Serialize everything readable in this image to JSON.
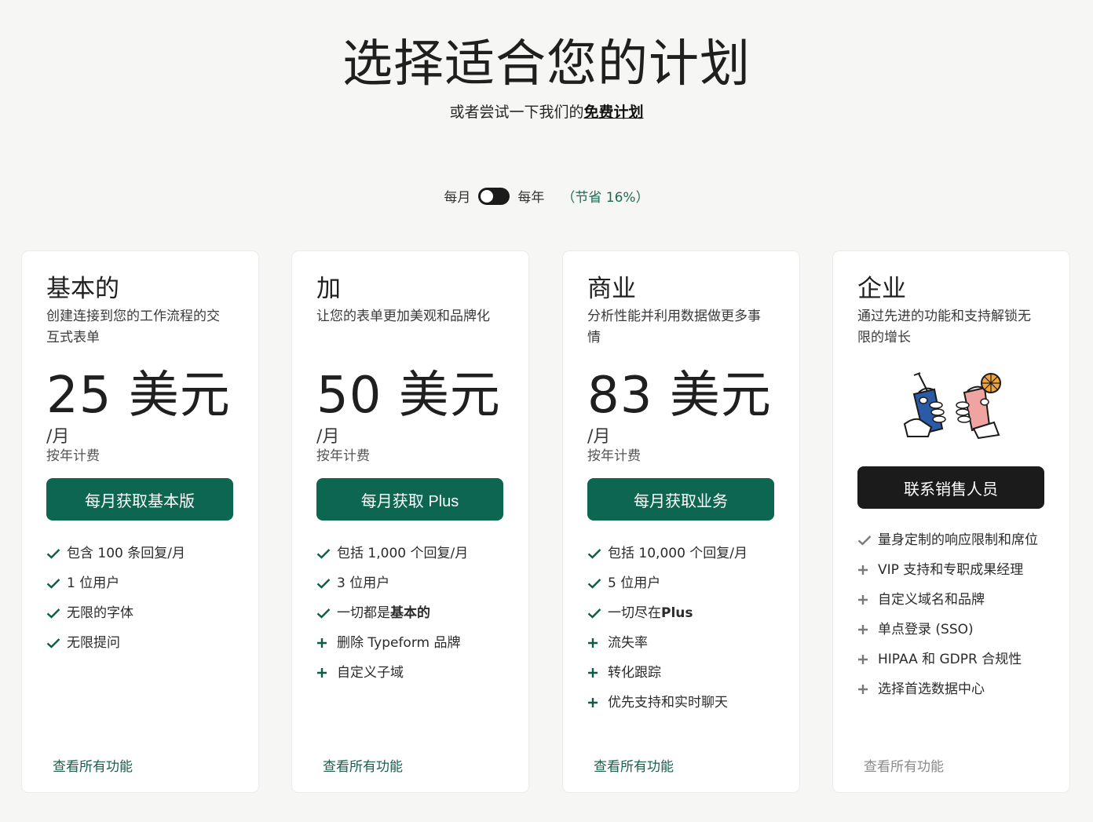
{
  "header": {
    "title": "选择适合您的计划",
    "subtitle_prefix": "或者尝试一下我们的",
    "subtitle_link": "免费计划"
  },
  "billing": {
    "monthly_label": "每月",
    "yearly_label": "每年",
    "savings": "（节省 16%）"
  },
  "plans": [
    {
      "name": "基本的",
      "description": "创建连接到您的工作流程的交互式表单",
      "price": "25 美元",
      "period": "/月",
      "billed": "按年计费",
      "cta": "每月获取基本版",
      "features": [
        {
          "icon": "check-icon",
          "text": "包含 100 条回复/月"
        },
        {
          "icon": "check-icon",
          "text": "1 位用户"
        },
        {
          "icon": "check-icon",
          "text": "无限的字体"
        },
        {
          "icon": "check-icon",
          "text": "无限提问"
        }
      ],
      "link": "查看所有功能"
    },
    {
      "name": "加",
      "description": "让您的表单更加美观和品牌化",
      "price": "50 美元",
      "period": "/月",
      "billed": "按年计费",
      "cta": "每月获取 Plus",
      "features": [
        {
          "icon": "check-icon",
          "text": "包括 1,000 个回复/月"
        },
        {
          "icon": "check-icon",
          "text": "3 位用户"
        },
        {
          "icon": "check-icon",
          "text": "一切都是",
          "bold": "基本的"
        },
        {
          "icon": "plus-icon",
          "text": "删除 Typeform 品牌"
        },
        {
          "icon": "plus-icon",
          "text": "自定义子域"
        }
      ],
      "link": "查看所有功能"
    },
    {
      "name": "商业",
      "description": "分析性能并利用数据做更多事情",
      "price": "83 美元",
      "period": "/月",
      "billed": "按年计费",
      "cta": "每月获取业务",
      "features": [
        {
          "icon": "check-icon",
          "text": "包括 10,000 个回复/月"
        },
        {
          "icon": "check-icon",
          "text": "5 位用户"
        },
        {
          "icon": "check-icon",
          "text": "一切尽在",
          "bold": "Plus"
        },
        {
          "icon": "plus-icon",
          "text": "流失率"
        },
        {
          "icon": "plus-icon",
          "text": "转化跟踪"
        },
        {
          "icon": "plus-icon",
          "text": "优先支持和实时聊天"
        }
      ],
      "link": "查看所有功能"
    },
    {
      "name": "企业",
      "description": "通过先进的功能和支持解锁无限的增长",
      "cta": "联系销售人员",
      "features": [
        {
          "icon": "check-icon",
          "text": "量身定制的响应限制和席位"
        },
        {
          "icon": "plus-icon",
          "text": "VIP 支持和专职成果经理"
        },
        {
          "icon": "plus-icon",
          "text": "自定义域名和品牌"
        },
        {
          "icon": "plus-icon",
          "text": "单点登录 (SSO)"
        },
        {
          "icon": "plus-icon",
          "text": "HIPAA 和 GDPR 合规性"
        },
        {
          "icon": "plus-icon",
          "text": "选择首选数据中心"
        }
      ],
      "link": "查看所有功能"
    }
  ],
  "colors": {
    "accent": "#0d6650",
    "dark_button": "#1b1b1b",
    "background": "#f6f6f4"
  }
}
